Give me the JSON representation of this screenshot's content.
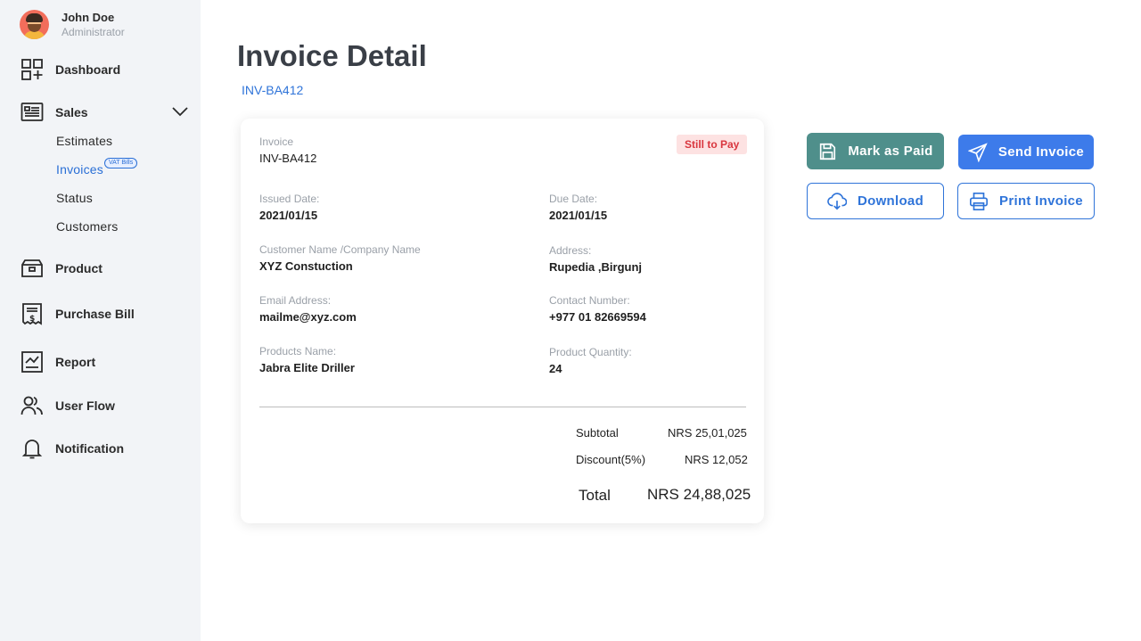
{
  "user": {
    "name": "John Doe",
    "role": "Administrator"
  },
  "nav": {
    "dashboard": "Dashboard",
    "sales": "Sales",
    "sales_items": [
      "Estimates",
      "Invoices",
      "Status",
      "Customers"
    ],
    "vat_badge": "VAT Bills",
    "product": "Product",
    "purchase_bill": "Purchase Bill",
    "report": "Report",
    "user_flow": "User Flow",
    "notification": "Notification"
  },
  "page": {
    "title": "Invoice Detail",
    "invoice_id": "INV-BA412"
  },
  "invoice": {
    "label": "Invoice",
    "number": "INV-BA412",
    "status": "Still to Pay",
    "issued_label": "Issued Date:",
    "issued": "2021/01/15",
    "due_label": "Due Date:",
    "due": "2021/01/15",
    "customer_label": "Customer Name /Company Name",
    "customer": "XYZ Constuction",
    "address_label": "Address:",
    "address": "Rupedia ,Birgunj",
    "email_label": "Email Address:",
    "email": "mailme@xyz.com",
    "contact_label": "Contact Number:",
    "contact": "+977 01 82669594",
    "products_label": "Products Name:",
    "products": "Jabra Elite Driller",
    "quantity_label": "Product Quantity:",
    "quantity": "24",
    "subtotal_label": "Subtotal",
    "subtotal": "NRS 25,01,025",
    "discount_label": "Discount(5%)",
    "discount": "NRS 12,052",
    "total_label": "Total",
    "total": "NRS 24,88,025"
  },
  "actions": {
    "mark_paid": "Mark as Paid",
    "send": "Send Invoice",
    "download": "Download",
    "print": "Print Invoice"
  },
  "colors": {
    "accent": "#2f74d9",
    "paid_button": "#4f8f8b",
    "send_button": "#3d7bea",
    "status_bg": "#fde2e2",
    "status_text": "#d9363e"
  }
}
